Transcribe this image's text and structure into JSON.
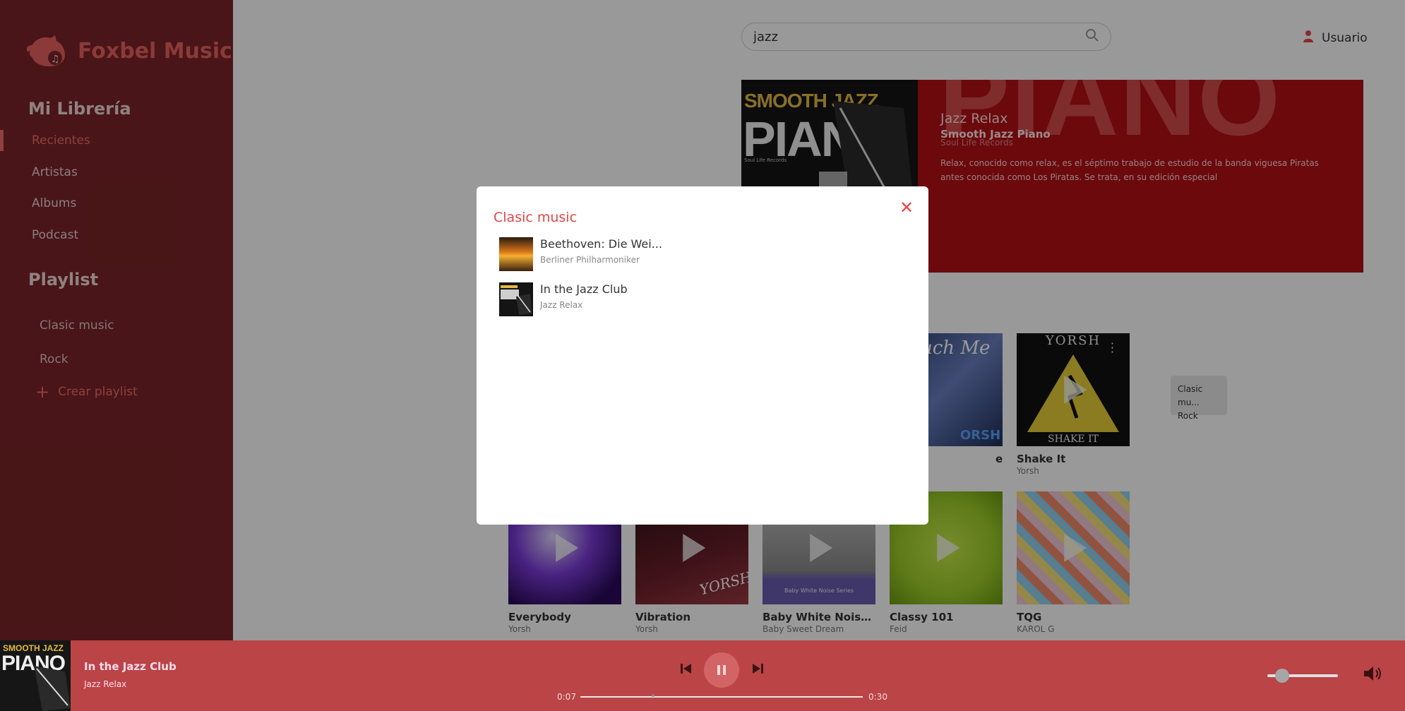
{
  "app": {
    "name": "Foxbel Music"
  },
  "sidebar": {
    "library_title": "Mi Librería",
    "items": [
      {
        "label": "Recientes",
        "active": true
      },
      {
        "label": "Artistas"
      },
      {
        "label": "Albums"
      },
      {
        "label": "Podcast"
      }
    ],
    "playlist_title": "Playlist",
    "playlists": [
      {
        "label": "Clasic music"
      },
      {
        "label": "Rock"
      }
    ],
    "create_playlist": "Crear playlist"
  },
  "header": {
    "search_value": "jazz",
    "user_label": "Usuario"
  },
  "hero": {
    "cover_line1": "SMOOTH JAZZ",
    "cover_line2": "PIANO",
    "cover_label": "Soul Life Records",
    "bg_word": "PIANO",
    "artist": "Jazz Relax",
    "album": "Smooth Jazz Piano",
    "label": "Soul Life Records",
    "description": "Relax, conocido como relax, es el séptimo trabajo de estudio de la banda viguesa Piratas antes conocida como Los Piratas. Se trata, en su edición especial"
  },
  "cards_row1": [
    {
      "name": "e",
      "artist": ""
    },
    {
      "name": "Shake It",
      "artist": "Yorsh",
      "art_text_top": "YORSH",
      "art_text_bottom": "SHAKE IT"
    }
  ],
  "partial_card": {
    "art_text": "uch Me",
    "art_text2": "ORSH"
  },
  "context_menu": {
    "items": [
      "Clasic mu...",
      "Rock"
    ]
  },
  "cards_row2": [
    {
      "name": "Everybody",
      "artist": "Yorsh"
    },
    {
      "name": "Vibration",
      "artist": "Yorsh",
      "art_text": "YORSH"
    },
    {
      "name": "Baby White Noise Ser...",
      "artist": "Baby Sweet Dream",
      "art_text": "Baby White Noise Series"
    },
    {
      "name": "Classy 101",
      "artist": "Feid"
    },
    {
      "name": "TQG",
      "artist": "KAROL G"
    }
  ],
  "modal": {
    "title": "Clasic music",
    "items": [
      {
        "title": "Beethoven: Die Wei...",
        "artist": "Berliner Philharmoniker"
      },
      {
        "title": "In the Jazz Club",
        "artist": "Jazz Relax"
      }
    ]
  },
  "player": {
    "cover_line1": "SMOOTH JAZZ",
    "cover_line2": "PIANO",
    "title": "In the Jazz Club",
    "artist": "Jazz Relax",
    "time_current": "0:07",
    "time_total": "0:30",
    "progress_fraction": 0.23,
    "volume_fraction": 0.25
  },
  "colors": {
    "accent": "#e64545",
    "sidebar": "#7a2428",
    "player": "#bb4446",
    "hero": "#b30f16"
  }
}
